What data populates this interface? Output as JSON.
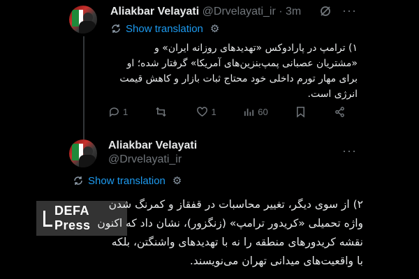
{
  "tweet1": {
    "name": "Aliakbar Velayati",
    "handle": "@Drvelayati_ir",
    "time": "· 3m",
    "translate_label": "Show translation",
    "body_lines": [
      "۱) ترامپ در پارادوکس «تهدیدهای روزانه ایران» و",
      "«مشتریان عصبانی پمپ‌بنزین‌های آمریکا» گرفتار شده؛ او",
      "برای مهار تورم داخلی خود محتاج ثبات بازار و کاهش قیمت",
      "انرژی است."
    ],
    "actions": {
      "replies": "1",
      "retweets": "",
      "likes": "1",
      "views": "60"
    }
  },
  "tweet2": {
    "name": "Aliakbar Velayati",
    "handle": "@Drvelayati_ir",
    "translate_label": "Show translation",
    "body_lines": [
      "۲) از سوی دیگر، تغییر محاسبات در قفقاز و کمرنگ شدن",
      "واژه تحمیلی «کریدور ترامپ» (زنگزور)، نشان داد که اکنون",
      "نقشه کریدورهای منطقه را نه با تهدیدهای واشنگتن، بلکه",
      "با واقعیت‌های میدانی تهران می‌نویسند."
    ]
  },
  "watermark": {
    "text": "DEFA Press"
  }
}
